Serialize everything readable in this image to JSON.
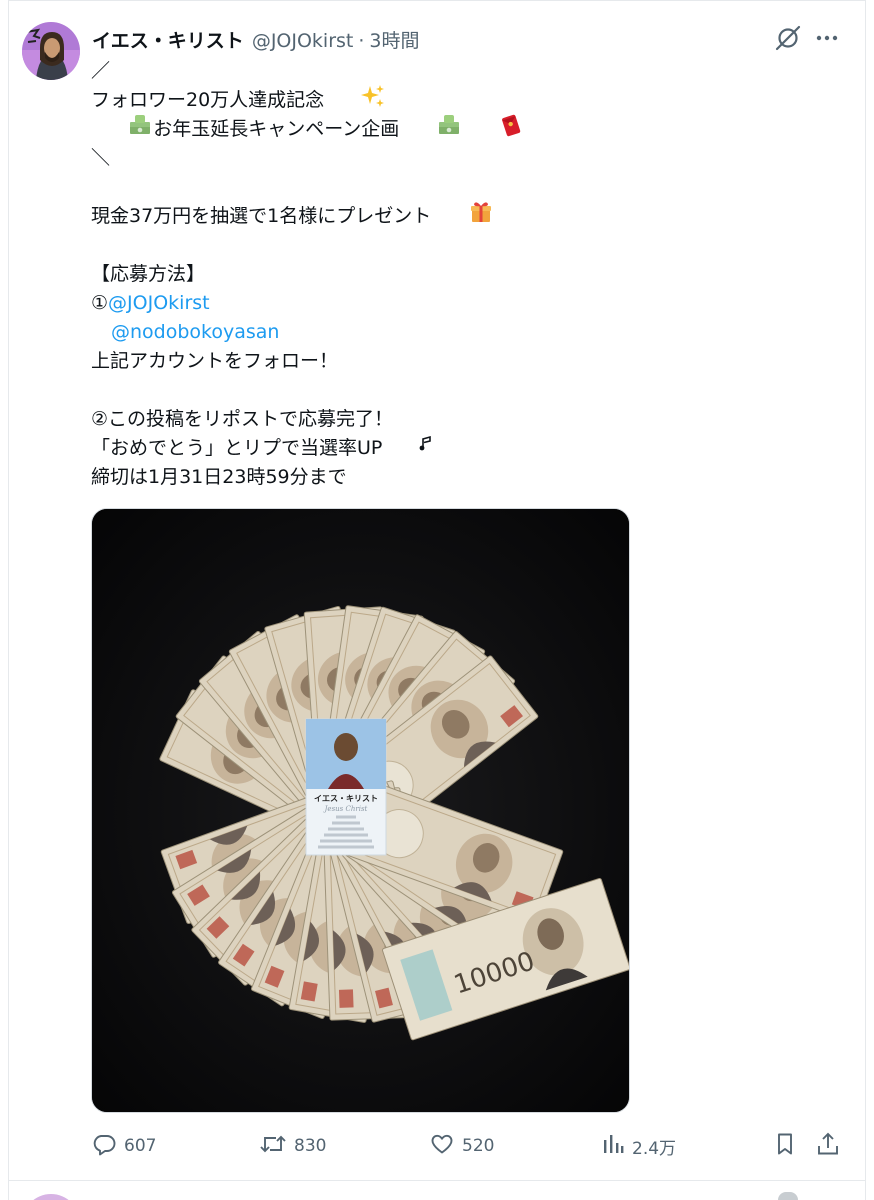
{
  "post": {
    "author": {
      "name": "イエス・キリスト",
      "handle": "@JOJOkirst",
      "separator": "·",
      "time": "3時間"
    },
    "lines": [
      "／",
      "フォロワー20万人達成記念",
      "お年玉延長キャンペーン企画",
      "＼",
      "",
      "現金37万円を抽選で1名様にプレゼント",
      "",
      "【応募方法】",
      "①",
      "@JOJOkirst",
      "@nodobokoyasan",
      "上記アカウントをフォロー！",
      "",
      "②この投稿をリポストで応募完了！",
      "「おめでとう」とリプで当選率UP",
      "締切は1月31日23時59分まで"
    ],
    "media": {
      "card_name": "イエス・キリスト",
      "card_subtitle": "Jesus Christ",
      "banknote_value": "10000"
    },
    "stats": {
      "replies": "607",
      "reposts": "830",
      "likes": "520",
      "views": "2.4万"
    }
  },
  "icons": [
    "grok-icon",
    "more-icon",
    "reply-icon",
    "repost-icon",
    "like-icon",
    "views-icon",
    "bookmark-icon",
    "share-icon"
  ],
  "colors": {
    "link": "#1d9bf0",
    "muted": "#536471",
    "text": "#0f1419",
    "border": "#e6e9ec"
  }
}
